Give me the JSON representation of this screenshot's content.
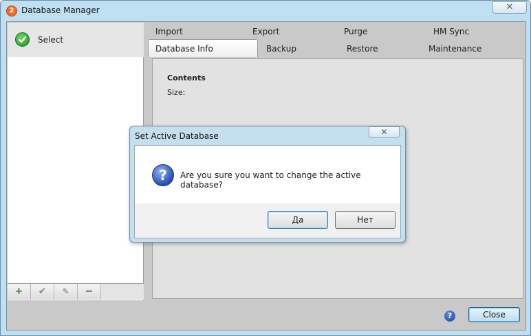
{
  "window": {
    "title": "Database Manager",
    "icon_glyph": "2",
    "close_glyph": "✕"
  },
  "sidebar": {
    "select_label": "Select",
    "toolbar": {
      "add_glyph": "+",
      "ok_glyph": "✔",
      "edit_glyph": "✎",
      "remove_glyph": "−"
    }
  },
  "tabs": {
    "row1": [
      "Import",
      "Export",
      "Purge",
      "HM Sync"
    ],
    "row2": [
      "Database Info",
      "Backup",
      "Restore",
      "Maintenance"
    ],
    "active": "Database Info"
  },
  "content": {
    "title": "Contents",
    "size_label": "Size:"
  },
  "footer": {
    "help_glyph": "?",
    "close_label": "Close"
  },
  "dialog": {
    "title": "Set Active Database",
    "close_glyph": "✕",
    "icon_glyph": "?",
    "message": "Are you sure you want to change the active database?",
    "yes_label": "Да",
    "no_label": "Нет"
  }
}
